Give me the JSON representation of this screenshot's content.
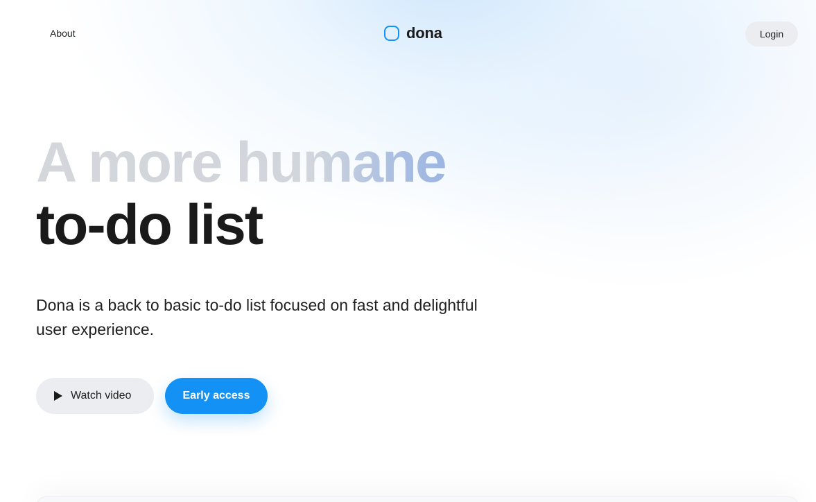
{
  "header": {
    "nav_about": "About",
    "logo_text": "dona",
    "login_label": "Login"
  },
  "hero": {
    "headline_line1": "A more humane",
    "headline_line2": "to-do list",
    "subtext": "Dona is a back to basic to-do list focused on fast and delightful user experience.",
    "watch_video_label": "Watch video",
    "early_access_label": "Early access"
  },
  "colors": {
    "accent": "#1391f5",
    "text": "#1a1a1a",
    "button_gray": "#ebedf0"
  },
  "icons": {
    "logo": "rounded-square-logo-icon",
    "play": "play-icon"
  }
}
